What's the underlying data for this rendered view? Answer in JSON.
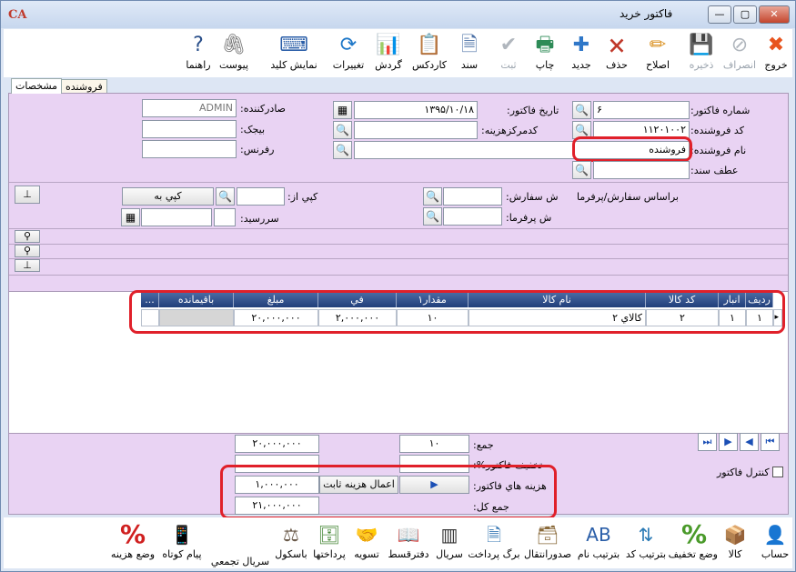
{
  "window": {
    "title": "فاکتور خريد",
    "logo": "CA",
    "minimize": "—",
    "maximize": "▢",
    "close": "✕"
  },
  "toolbar": [
    {
      "id": "exit",
      "label": "خروج",
      "icon": "✖",
      "color": "#e8541e",
      "disabled": false
    },
    {
      "id": "cancel",
      "label": "انصراف",
      "icon": "⊘",
      "color": "#7a7a7a",
      "disabled": true
    },
    {
      "id": "save",
      "label": "ذخيره",
      "icon": "💾",
      "color": "#555",
      "disabled": true
    },
    {
      "id": "edit",
      "label": "اصلاح",
      "icon": "✏",
      "color": "#d98e1a",
      "disabled": false
    },
    {
      "id": "delete",
      "label": "حذف",
      "icon": "🗙",
      "color": "#c0392b",
      "disabled": false
    },
    {
      "id": "new",
      "label": "جديد",
      "icon": "✚",
      "color": "#2f77c8",
      "disabled": false
    },
    {
      "id": "print",
      "label": "چاپ",
      "icon": "🖶",
      "color": "#2e8b57",
      "disabled": false
    },
    {
      "id": "register",
      "label": "ثبت",
      "icon": "✔",
      "color": "#7a7a7a",
      "disabled": true
    },
    {
      "id": "document",
      "label": "سند",
      "icon": "🗎",
      "color": "#4a6fa5",
      "disabled": false
    },
    {
      "id": "cardex",
      "label": "کاردکس",
      "icon": "📋",
      "color": "#b07a1e",
      "disabled": false
    },
    {
      "id": "turnover",
      "label": "گردش",
      "icon": "📊",
      "color": "#2e6fb5",
      "disabled": false
    },
    {
      "id": "changes",
      "label": "تغييرات",
      "icon": "⟳",
      "color": "#1f78c8",
      "disabled": false
    },
    {
      "id": "show-key",
      "label": "نمايش کليد",
      "icon": "⌨",
      "color": "#2a5ea8",
      "disabled": false
    },
    {
      "id": "attachment",
      "label": "پيوست",
      "icon": "🖇",
      "color": "#777",
      "disabled": false
    },
    {
      "id": "help",
      "label": "راهنما",
      "icon": "?",
      "color": "#2a4f8a",
      "disabled": false
    }
  ],
  "tabs": {
    "specs": "مشخصات",
    "vendor": "فروشنده"
  },
  "form": {
    "invoice_no_label": "شماره فاکتور:",
    "invoice_no": "۶",
    "vendor_code_label": "کد فروشنده:",
    "vendor_code": "۱۱۲۰۱۰۰۲",
    "vendor_name_label": "نام فروشنده:",
    "vendor_name": "فروشنده",
    "doc_ref_label": "عطف سند:",
    "doc_ref": "",
    "invoice_date_label": "تاريخ فاکتور:",
    "invoice_date": "۱۳۹۵/۱۰/۱۸",
    "cost_center_label": "کدمرکزهزينه:",
    "cost_center": "",
    "issuer_label": "صادرکننده:",
    "issuer": "ADMIN",
    "receipt_label": "بيجک:",
    "receipt": "",
    "reference_label": "رفرنس:",
    "reference": "",
    "based_on_label": "براساس سفارش/پرفرما",
    "order_no_label": "ش سفارش:",
    "order_no": "",
    "proforma_no_label": "ش پرفرما:",
    "proforma_no": "",
    "copy_from_label": "کپي از:",
    "copy_from": "",
    "copy_to_button": "کپي به",
    "due_date_label": "سررسيد:",
    "due_date": ""
  },
  "grid": {
    "columns": [
      "رديف",
      "انبار",
      "کد کالا",
      "نام کالا",
      "مقدار۱",
      "في",
      "مبلغ",
      "باقيمانده",
      "..."
    ],
    "rows": [
      {
        "row": "۱",
        "warehouse": "۱",
        "code": "۲",
        "name": "کالاي ۲",
        "qty": "۱۰",
        "price": "۲,۰۰۰,۰۰۰",
        "amount": "۲۰,۰۰۰,۰۰۰",
        "remaining": ""
      }
    ]
  },
  "totals": {
    "sum_label": "جمع:",
    "sum_amount": "۲۰,۰۰۰,۰۰۰",
    "sum_qty": "۱۰",
    "discount_label": "تخفيف فاکتور%:",
    "costs_label": "هزينه هاي فاکتور:",
    "costs_amount": "۱,۰۰۰,۰۰۰",
    "apply_fixed_cost_button": "اعمال هزينه ثابت",
    "grand_total_label": "جمع کل:",
    "grand_total": "۲۱,۰۰۰,۰۰۰",
    "invoice_control_label": "کنترل فاکتور"
  },
  "bottombar": [
    {
      "id": "account",
      "label": "حساب",
      "icon": "👤",
      "color": "#2a5ea8"
    },
    {
      "id": "goods",
      "label": "کالا",
      "icon": "📦",
      "color": "#a06a2a"
    },
    {
      "id": "set-discount",
      "label": "وضع تخفيف",
      "icon": "%",
      "color": "#4a9a2a"
    },
    {
      "id": "sort-code",
      "label": "بترتيب کد",
      "icon": "⇅",
      "color": "#2a7ab5"
    },
    {
      "id": "sort-name",
      "label": "بترتيب نام",
      "icon": "AB",
      "color": "#2a5ea8"
    },
    {
      "id": "issue-transfer",
      "label": "صدورانتقال",
      "icon": "🗃",
      "color": "#8a6a3a"
    },
    {
      "id": "payment-slip",
      "label": "برگ پرداخت",
      "icon": "🗎",
      "color": "#3a7ab5"
    },
    {
      "id": "serial",
      "label": "سريال",
      "icon": "▥",
      "color": "#333"
    },
    {
      "id": "installment-book",
      "label": "دفترقسط",
      "icon": "📖",
      "color": "#8a5a2a"
    },
    {
      "id": "settlement",
      "label": "تسويه",
      "icon": "🤝",
      "color": "#d08a1a"
    },
    {
      "id": "payments",
      "label": "پرداختها",
      "icon": "🗄",
      "color": "#4a8a3a"
    },
    {
      "id": "basket",
      "label": "باسکول",
      "icon": "⚖",
      "color": "#6a5a4a"
    },
    {
      "id": "bulk-serial",
      "label": "سريال تجمعي",
      "icon": "",
      "color": "#333"
    },
    {
      "id": "short-message",
      "label": "پيام کوتاه",
      "icon": "📱",
      "color": "#2a5ea8"
    },
    {
      "id": "set-cost",
      "label": "وضع هزينه",
      "icon": "%",
      "color": "#d02020"
    }
  ]
}
